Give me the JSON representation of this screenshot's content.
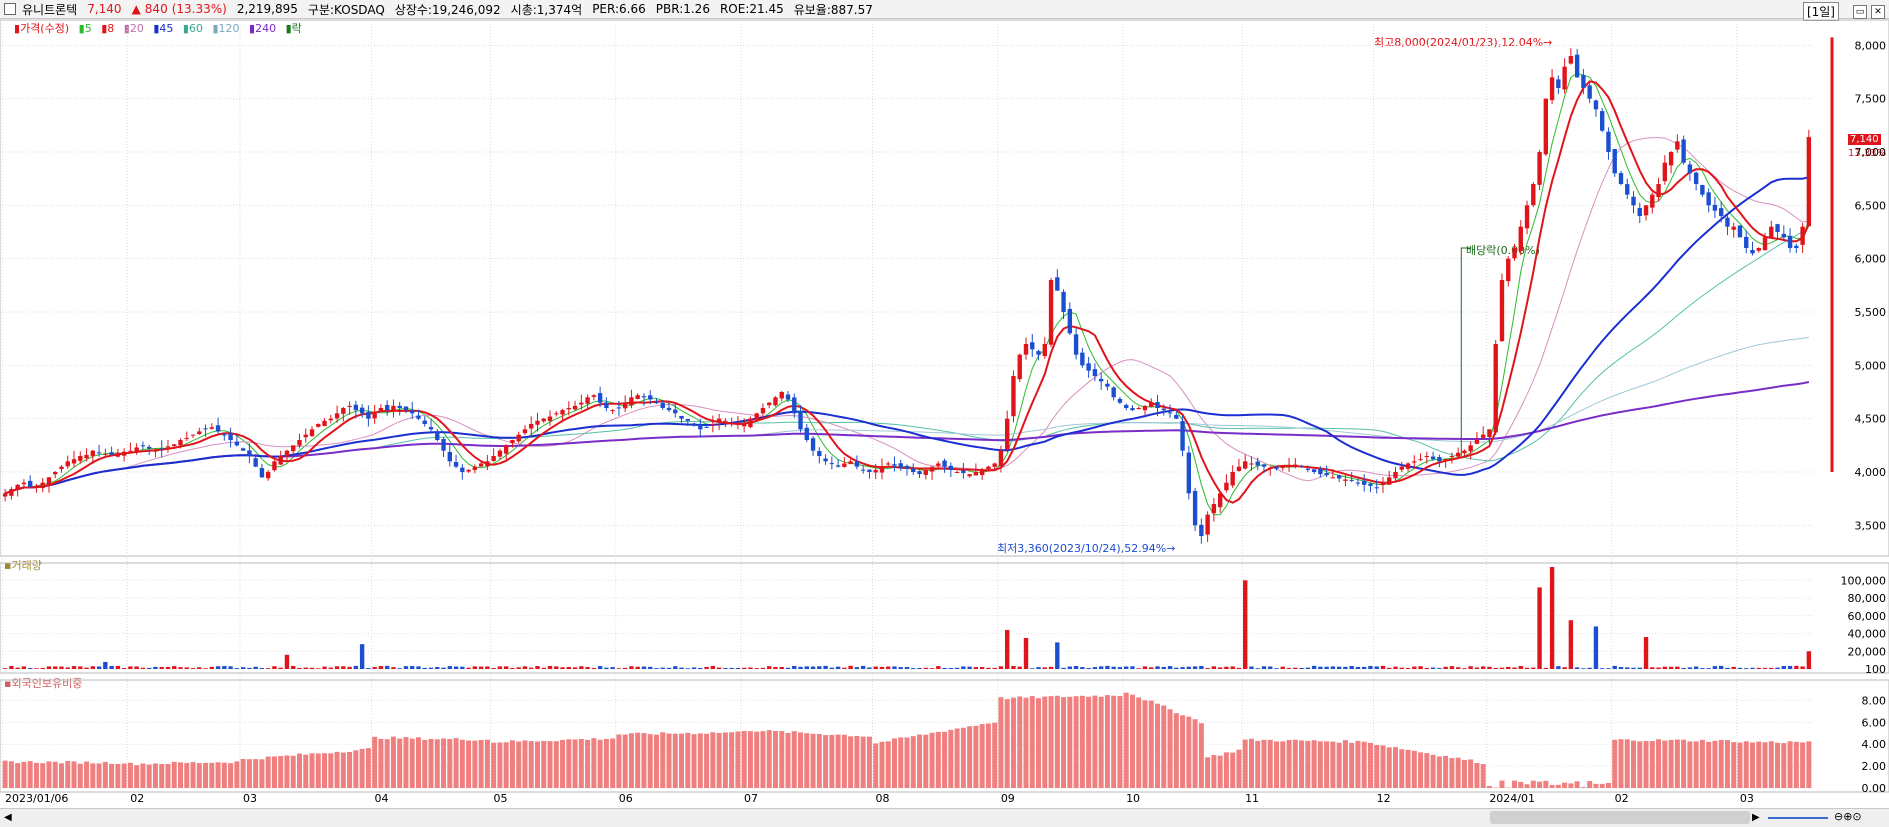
{
  "header": {
    "name": "유니트론텍",
    "price": "7,140",
    "change_arrow": "▲",
    "change": "840",
    "change_pct": "(13.33%)",
    "volume": "2,219,895",
    "market": "구분:KOSDAQ",
    "shares": "상장수:19,246,092",
    "mcap": "시총:1,374억",
    "per": "PER:6.66",
    "pbr": "PBR:1.26",
    "roe": "ROE:21.45",
    "float": "유보율:887.57",
    "period": "[1일]"
  },
  "legend": {
    "price": "가격(수정)",
    "ma5": "5",
    "ma8": "8",
    "ma20": "20",
    "ma45": "45",
    "ma60": "60",
    "ma120": "120",
    "ma240": "240",
    "ex": "락"
  },
  "volume_panel": {
    "title": "거래량"
  },
  "foreign_panel": {
    "title": "외국인보유비중"
  },
  "annotations": {
    "high": "최고8,000(2024/01/23),12.04%→",
    "low": "최저3,360(2023/10/24),52.94%→",
    "dividend": "배당락(0.00%)",
    "last_price": "7,140",
    "last_pct": "13.33%"
  },
  "colors": {
    "up": "#e0151b",
    "down": "#1b4fd0",
    "ma5": "#2db92d",
    "ma8": "#e0151b",
    "ma20": "#d890c0",
    "ma45": "#1b2fd0",
    "ma60": "#55c0a8",
    "ma120": "#a0c8d8",
    "ma240": "#7a2cc8",
    "foreign": "#f08080"
  },
  "chart_data": [
    {
      "type": "candlestick",
      "title": "유니트론텍",
      "y_ticks": [
        3500,
        4000,
        4500,
        5000,
        5500,
        6000,
        6500,
        7000,
        7500,
        8000
      ],
      "y_tick_labels": [
        "3,500",
        "4,000",
        "4,500",
        "5,000",
        "5,500",
        "6,000",
        "6,500",
        "7,000",
        "7,500",
        "8,000"
      ],
      "ylim": [
        3250,
        8200
      ],
      "x_tick_labels": [
        "2023/01/06",
        "02",
        "03",
        "04",
        "05",
        "06",
        "07",
        "08",
        "09",
        "10",
        "11",
        "12",
        "2024/01",
        "02",
        "03"
      ],
      "x_tick_index": [
        0,
        20,
        38,
        59,
        78,
        98,
        118,
        139,
        159,
        179,
        198,
        219,
        237,
        257,
        277
      ],
      "close_series_by_month": [
        {
          "x": "2023/01",
          "close": [
            3800,
            3840,
            3880,
            3900,
            3860,
            3870,
            3900,
            3950,
            4000,
            4050,
            4100,
            4120,
            4150,
            4160,
            4200,
            4180,
            4170,
            4160,
            4180,
            4190
          ]
        },
        {
          "x": "2023/02",
          "close": [
            4200,
            4230,
            4250,
            4220,
            4200,
            4210,
            4240,
            4260,
            4300,
            4320,
            4350,
            4380,
            4400,
            4420,
            4380,
            4350,
            4300,
            4250
          ]
        },
        {
          "x": "2023/03",
          "close": [
            4200,
            4150,
            4050,
            3950,
            4000,
            4100,
            4150,
            4200,
            4250,
            4300,
            4350,
            4400,
            4450,
            4480,
            4500,
            4550,
            4600,
            4620,
            4580,
            4550,
            4500
          ]
        },
        {
          "x": "2023/04",
          "close": [
            4550,
            4600,
            4580,
            4620,
            4600,
            4580,
            4550,
            4500,
            4450,
            4400,
            4300,
            4200,
            4100,
            4050,
            4000,
            4020,
            4050,
            4080,
            4100
          ]
        },
        {
          "x": "2023/05",
          "close": [
            4150,
            4200,
            4250,
            4300,
            4350,
            4400,
            4450,
            4480,
            4500,
            4520,
            4550,
            4580,
            4600,
            4620,
            4650,
            4700,
            4720,
            4650,
            4600,
            4580
          ]
        },
        {
          "x": "2023/06",
          "close": [
            4600,
            4650,
            4700,
            4720,
            4700,
            4680,
            4650,
            4600,
            4580,
            4550,
            4500,
            4480,
            4450,
            4400,
            4420,
            4450,
            4500,
            4480,
            4460,
            4450
          ]
        },
        {
          "x": "2023/07",
          "close": [
            4450,
            4500,
            4550,
            4600,
            4650,
            4700,
            4750,
            4680,
            4550,
            4400,
            4300,
            4200,
            4150,
            4100,
            4080,
            4050,
            4080,
            4100,
            4050,
            4020,
            4000
          ]
        },
        {
          "x": "2023/08",
          "close": [
            4020,
            4050,
            4080,
            4060,
            4040,
            4030,
            4000,
            3980,
            4020,
            4050,
            4080,
            4050,
            4020,
            4000,
            3990,
            3980,
            4000,
            4020,
            4050,
            4080
          ]
        },
        {
          "x": "2023/09",
          "close": [
            4200,
            4500,
            4900,
            5100,
            5200,
            5150,
            5100,
            5200,
            5800,
            5700,
            5500,
            5300,
            5100,
            5000,
            4950,
            4900,
            4850,
            4800
          ]
        },
        {
          "x": "2023/10",
          "close": [
            4700,
            4650,
            4600,
            4580,
            4600,
            4620,
            4650,
            4600,
            4580,
            4550,
            4500,
            4200,
            3800,
            3500,
            3400,
            3600,
            3700,
            3800,
            3900,
            4000
          ]
        },
        {
          "x": "2023/11",
          "close": [
            4050,
            4100,
            4080,
            4060,
            4050,
            4040,
            4030,
            4050,
            4060,
            4070,
            4050,
            4020,
            4000,
            3980,
            3970,
            3950,
            3940,
            3930,
            3920,
            3900,
            3880,
            3870
          ]
        },
        {
          "x": "2023/12",
          "close": [
            3850,
            3900,
            3950,
            4000,
            4050,
            4080,
            4100,
            4120,
            4150,
            4120,
            4100,
            4120,
            4150,
            4180,
            4200,
            4250,
            4300,
            4350
          ]
        },
        {
          "x": "2024/01",
          "close": [
            4400,
            5200,
            5800,
            6000,
            6100,
            6300,
            6500,
            6700,
            7000,
            7500,
            7700,
            7600,
            7800,
            7900,
            7700,
            7600,
            7500,
            7400,
            7200,
            7000
          ]
        },
        {
          "x": "2024/02",
          "close": [
            6800,
            6700,
            6600,
            6500,
            6400,
            6500,
            6600,
            6700,
            6900,
            7000,
            7100,
            6900,
            6800,
            6700,
            6600,
            6500,
            6450,
            6400,
            6300,
            6300
          ]
        },
        {
          "x": "2024/03",
          "close": [
            6200,
            6100,
            6050,
            6100,
            6200,
            6300,
            6250,
            6200,
            6100,
            6100,
            6300,
            7140
          ]
        }
      ],
      "high": {
        "date": "2024/01/23",
        "value": 8000
      },
      "low": {
        "date": "2023/10/24",
        "value": 3360
      },
      "last": 7140
    },
    {
      "type": "bar",
      "title": "거래량",
      "y_ticks": [
        100,
        20000,
        40000,
        60000,
        80000,
        100000
      ],
      "y_tick_labels": [
        "100",
        "20,000",
        "40,000",
        "60,000",
        "80,000",
        "100,000"
      ],
      "ylim": [
        0,
        115000
      ],
      "spikes": [
        {
          "x": "2023/01 late",
          "value": 8000
        },
        {
          "x": "2023/03",
          "value": 16000
        },
        {
          "x": "2023/04",
          "value": 28000
        },
        {
          "x": "2023/09",
          "value": 44000
        },
        {
          "x": "2023/09",
          "value": 35000
        },
        {
          "x": "2023/09",
          "value": 30000
        },
        {
          "x": "2023/10",
          "value": 100000
        },
        {
          "x": "2024/01",
          "value": 92000
        },
        {
          "x": "2024/01",
          "value": 115000
        },
        {
          "x": "2024/01",
          "value": 55000
        },
        {
          "x": "2024/01",
          "value": 48000
        },
        {
          "x": "2024/01",
          "value": 36000
        },
        {
          "x": "2024/03 last",
          "value": 20000
        }
      ],
      "baseline_typical": 2000
    },
    {
      "type": "bar",
      "title": "외국인보유비중",
      "y_ticks": [
        0.0,
        2.0,
        4.0,
        6.0,
        8.0
      ],
      "y_tick_labels": [
        "0.00",
        "2.00",
        "4.00",
        "6.00",
        "8.00"
      ],
      "ylim": [
        0,
        9.5
      ],
      "monthly_levels": [
        {
          "x": "2023/01",
          "value": 2.4
        },
        {
          "x": "2023/02",
          "value": 2.2
        },
        {
          "x": "2023/03",
          "value": 2.6
        },
        {
          "x": "2023/04",
          "value": 4.6
        },
        {
          "x": "2023/05",
          "value": 4.2
        },
        {
          "x": "2023/06",
          "value": 4.9
        },
        {
          "x": "2023/07",
          "value": 5.3
        },
        {
          "x": "2023/08",
          "value": 4.1
        },
        {
          "x": "2023/09",
          "value": 8.2
        },
        {
          "x": "2023/10",
          "value": 8.8
        },
        {
          "x": "2023/10 late",
          "value": 2.8
        },
        {
          "x": "2023/11",
          "value": 4.4
        },
        {
          "x": "2023/12",
          "value": 4.0
        },
        {
          "x": "2024/01",
          "value": 0.4
        },
        {
          "x": "2024/02",
          "value": 4.4
        },
        {
          "x": "2024/03",
          "value": 4.2
        }
      ]
    }
  ]
}
